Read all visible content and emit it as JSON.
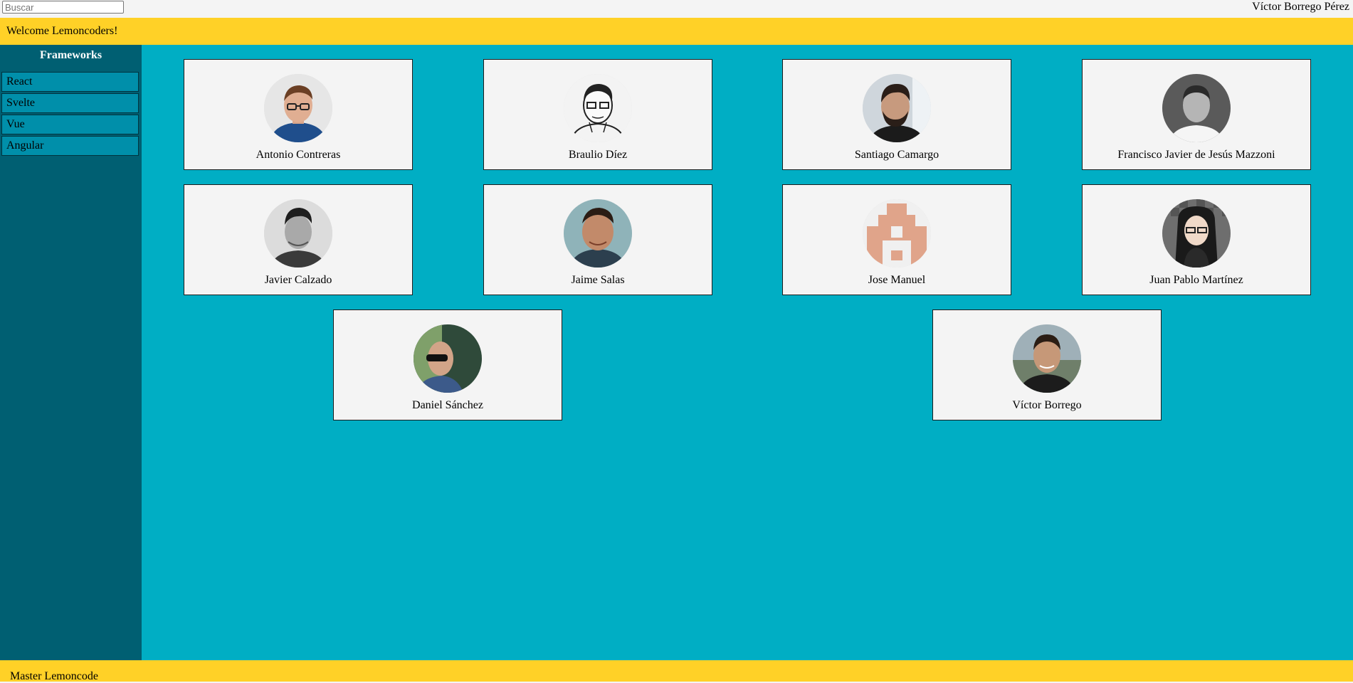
{
  "header": {
    "search_placeholder": "Buscar",
    "search_value": "",
    "user_name": "Víctor Borrego Pérez"
  },
  "banner": {
    "text": "Welcome Lemoncoders!"
  },
  "sidebar": {
    "title": "Frameworks",
    "items": [
      {
        "label": "React"
      },
      {
        "label": "Svelte"
      },
      {
        "label": "Vue"
      },
      {
        "label": "Angular"
      }
    ]
  },
  "members": [
    {
      "name": "Antonio Contreras",
      "avatar": "photo-man-glasses"
    },
    {
      "name": "Braulio Díez",
      "avatar": "sketch-man-glasses"
    },
    {
      "name": "Santiago Camargo",
      "avatar": "photo-man-beard"
    },
    {
      "name": "Francisco Javier de Jesús Mazzoni",
      "avatar": "photo-man-grayscale"
    },
    {
      "name": "Javier Calzado",
      "avatar": "photo-man-grayscale"
    },
    {
      "name": "Jaime Salas",
      "avatar": "photo-man-smiling"
    },
    {
      "name": "Jose Manuel",
      "avatar": "identicon"
    },
    {
      "name": "Juan Pablo Martínez",
      "avatar": "cartoon-man-long-hair"
    },
    {
      "name": "Daniel Sánchez",
      "avatar": "photo-man-sunglasses"
    },
    {
      "name": "Víctor Borrego",
      "avatar": "photo-man-outdoors"
    }
  ],
  "footer": {
    "text": "Master Lemoncode"
  },
  "colors": {
    "banner": "#ffd127",
    "sidebar": "#005f72",
    "menu_item": "#008faa",
    "main": "#00aec4",
    "card": "#f4f4f4"
  }
}
